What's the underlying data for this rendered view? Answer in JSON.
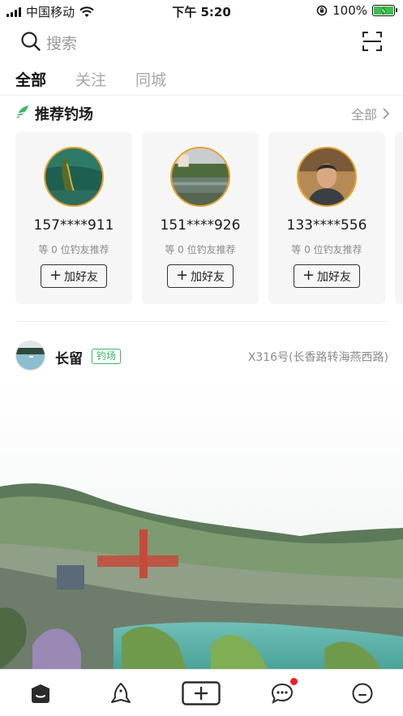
{
  "status_bar": {
    "carrier": "中国移动",
    "time": "下午 5:20",
    "battery": "100%"
  },
  "search": {
    "placeholder": "搜索"
  },
  "tabs": [
    {
      "label": "全部",
      "active": true
    },
    {
      "label": "关注",
      "active": false
    },
    {
      "label": "同城",
      "active": false
    }
  ],
  "recommend": {
    "title": "推荐钓场",
    "all_label": "全部",
    "accent_color": "#3bb76a",
    "cards": [
      {
        "name": "157****911",
        "sub": "等 0 位钓友推荐",
        "button": "加好友"
      },
      {
        "name": "151****926",
        "sub": "等 0 位钓友推荐",
        "button": "加好友"
      },
      {
        "name": "133****556",
        "sub": "等 0 位钓友推荐",
        "button": "加好友"
      }
    ]
  },
  "post": {
    "author": "长留",
    "badge": "钓场",
    "location": "X316号(长香路转海燕西路)"
  },
  "bottom_nav": {
    "items": [
      "home-icon",
      "fish-icon",
      "add-icon",
      "message-icon",
      "profile-icon"
    ],
    "message_has_dot": true
  }
}
